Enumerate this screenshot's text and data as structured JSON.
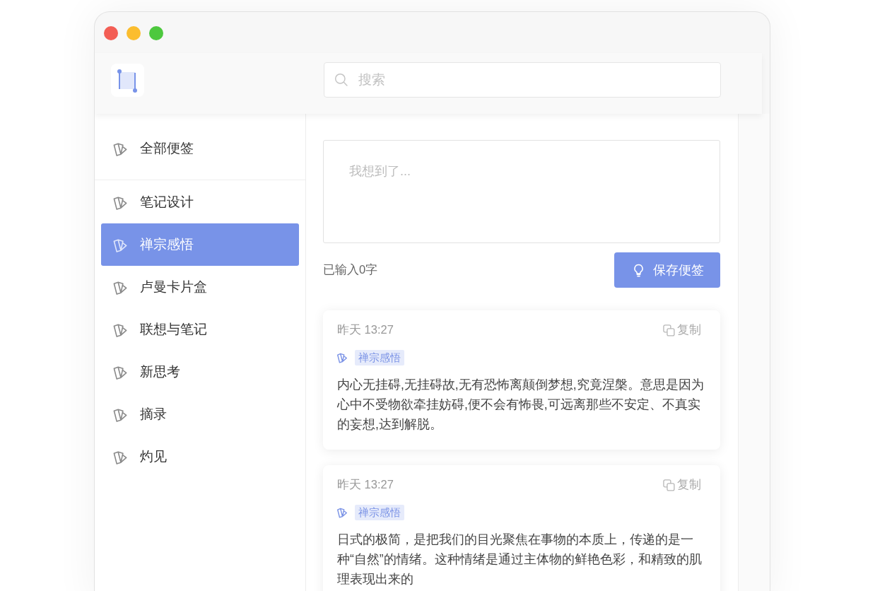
{
  "search": {
    "placeholder": "搜索"
  },
  "sidebar": {
    "items": [
      {
        "kind": "all",
        "label": "全部便签",
        "selected": false
      },
      {
        "kind": "category",
        "label": "笔记设计",
        "selected": false
      },
      {
        "kind": "category",
        "label": "禅宗感悟",
        "selected": true
      },
      {
        "kind": "category",
        "label": "卢曼卡片盒",
        "selected": false
      },
      {
        "kind": "category",
        "label": "联想与笔记",
        "selected": false
      },
      {
        "kind": "category",
        "label": "新思考",
        "selected": false
      },
      {
        "kind": "category",
        "label": "摘录",
        "selected": false
      },
      {
        "kind": "category",
        "label": "灼见",
        "selected": false
      }
    ]
  },
  "composer": {
    "placeholder": "我想到了...",
    "char_count": "已输入0字",
    "save_button": "保存便签"
  },
  "notes": [
    {
      "time": "昨天 13:27",
      "copy_button": "复制",
      "tag": "禅宗感悟",
      "text": "内心无挂碍,无挂碍故,无有恐怖离颠倒梦想,究竟涅槃。意思是因为心中不受物欲牵挂妨碍,便不会有怖畏,可远离那些不安定、不真实的妄想,达到解脱。"
    },
    {
      "time": "昨天 13:27",
      "copy_button": "复制",
      "tag": "禅宗感悟",
      "text": "日式的极简，是把我们的目光聚焦在事物的本质上，传递的是一种“自然”的情绪。这种情绪是通过主体物的鲜艳色彩，和精致的肌理表现出来的"
    }
  ]
}
